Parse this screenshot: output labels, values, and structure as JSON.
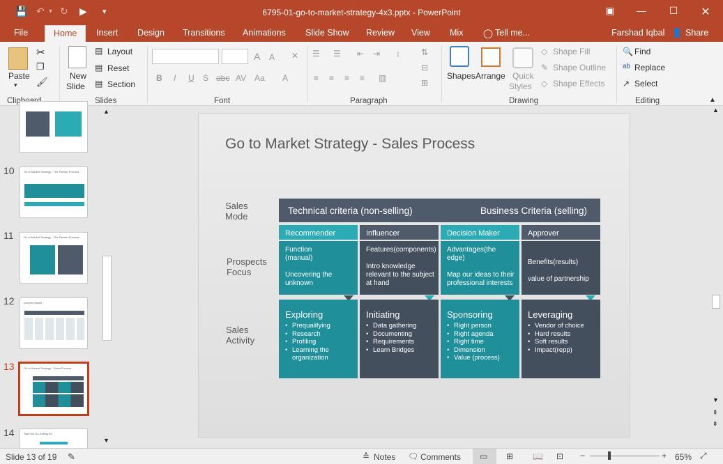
{
  "window": {
    "title": "6795-01-go-to-market-strategy-4x3.pptx - PowerPoint"
  },
  "quick_access": {
    "save_icon": "save-icon",
    "undo_icon": "undo-icon",
    "redo_icon": "redo-icon",
    "present_icon": "start-from-beginning-icon",
    "more_icon": "customize-quick-access-icon"
  },
  "tabs": [
    "File",
    "Home",
    "Insert",
    "Design",
    "Transitions",
    "Animations",
    "Slide Show",
    "Review",
    "View",
    "Mix"
  ],
  "tell_me": "Tell me...",
  "user": {
    "name": "Farshad Iqbal",
    "share": "Share"
  },
  "ribbon": {
    "clipboard": {
      "label": "Clipboard",
      "paste": "Paste"
    },
    "slides": {
      "label": "Slides",
      "new_slide_1": "New",
      "new_slide_2": "Slide",
      "layout": "Layout",
      "reset": "Reset",
      "section": "Section"
    },
    "font": {
      "label": "Font"
    },
    "paragraph": {
      "label": "Paragraph"
    },
    "drawing": {
      "label": "Drawing",
      "shapes": "Shapes",
      "arrange": "Arrange",
      "quick_styles_1": "Quick",
      "quick_styles_2": "Styles",
      "shape_fill": "Shape Fill",
      "shape_outline": "Shape Outline",
      "shape_effects": "Shape Effects"
    },
    "editing": {
      "label": "Editing",
      "find": "Find",
      "replace": "Replace",
      "select": "Select"
    }
  },
  "thumbnails": [
    {
      "num": "10",
      "title": "Go to Market Strategy - The Partner Process"
    },
    {
      "num": "11",
      "title": "Go to Market Strategy - The Partner Process"
    },
    {
      "num": "12",
      "title": "Journey Board"
    },
    {
      "num": "13",
      "title": "Go to Market Strategy - Sales Process"
    },
    {
      "num": "14",
      "title": "Take the Go-Selling 5C"
    }
  ],
  "slide": {
    "title": "Go to Market Strategy - Sales Process",
    "row_labels": {
      "mode": "Sales\nMode",
      "focus": "Prospects\nFocus",
      "activity": "Sales\nActivity"
    },
    "header_left": "Technical criteria (non-selling)",
    "header_right": "Business Criteria (selling)",
    "columns": [
      {
        "role": "Recommender",
        "focus": [
          "Function",
          "(manual)",
          "",
          "Uncovering the",
          "unknown"
        ],
        "activity": "Exploring",
        "items": [
          "Prequalifying",
          "Research",
          "Profiling",
          "Learning the organization"
        ]
      },
      {
        "role": "Influencer",
        "focus": [
          "Features(components)",
          "",
          "Intro knowledge",
          "relevant to the subject",
          "at hand"
        ],
        "activity": "Initiating",
        "items": [
          "Data gathering",
          "Documenting",
          "Requirements",
          "Learn Bridges"
        ]
      },
      {
        "role": "Decision Maker",
        "focus": [
          "Advantages(the",
          "edge)",
          "",
          "Map our ideas to their",
          "professional interests"
        ],
        "activity": "Sponsoring",
        "items": [
          "Right person",
          "Right agenda",
          "Right time",
          "Dimension",
          "Value (process)"
        ]
      },
      {
        "role": "Approver",
        "focus": [
          "",
          "Benefits(results)",
          "",
          "value of partnership"
        ],
        "activity": "Leveraging",
        "items": [
          "Vendor of choice",
          "Hard results",
          "Soft results",
          "Impact(repp)"
        ]
      }
    ]
  },
  "status": {
    "slide_info": "Slide 13 of 19",
    "notes": "Notes",
    "comments": "Comments",
    "zoom": "65%"
  },
  "colors": {
    "accent": "#b7472a",
    "teal": "#1f8f9a",
    "teal_header": "#2bacb4",
    "slate": "#444f5e"
  }
}
